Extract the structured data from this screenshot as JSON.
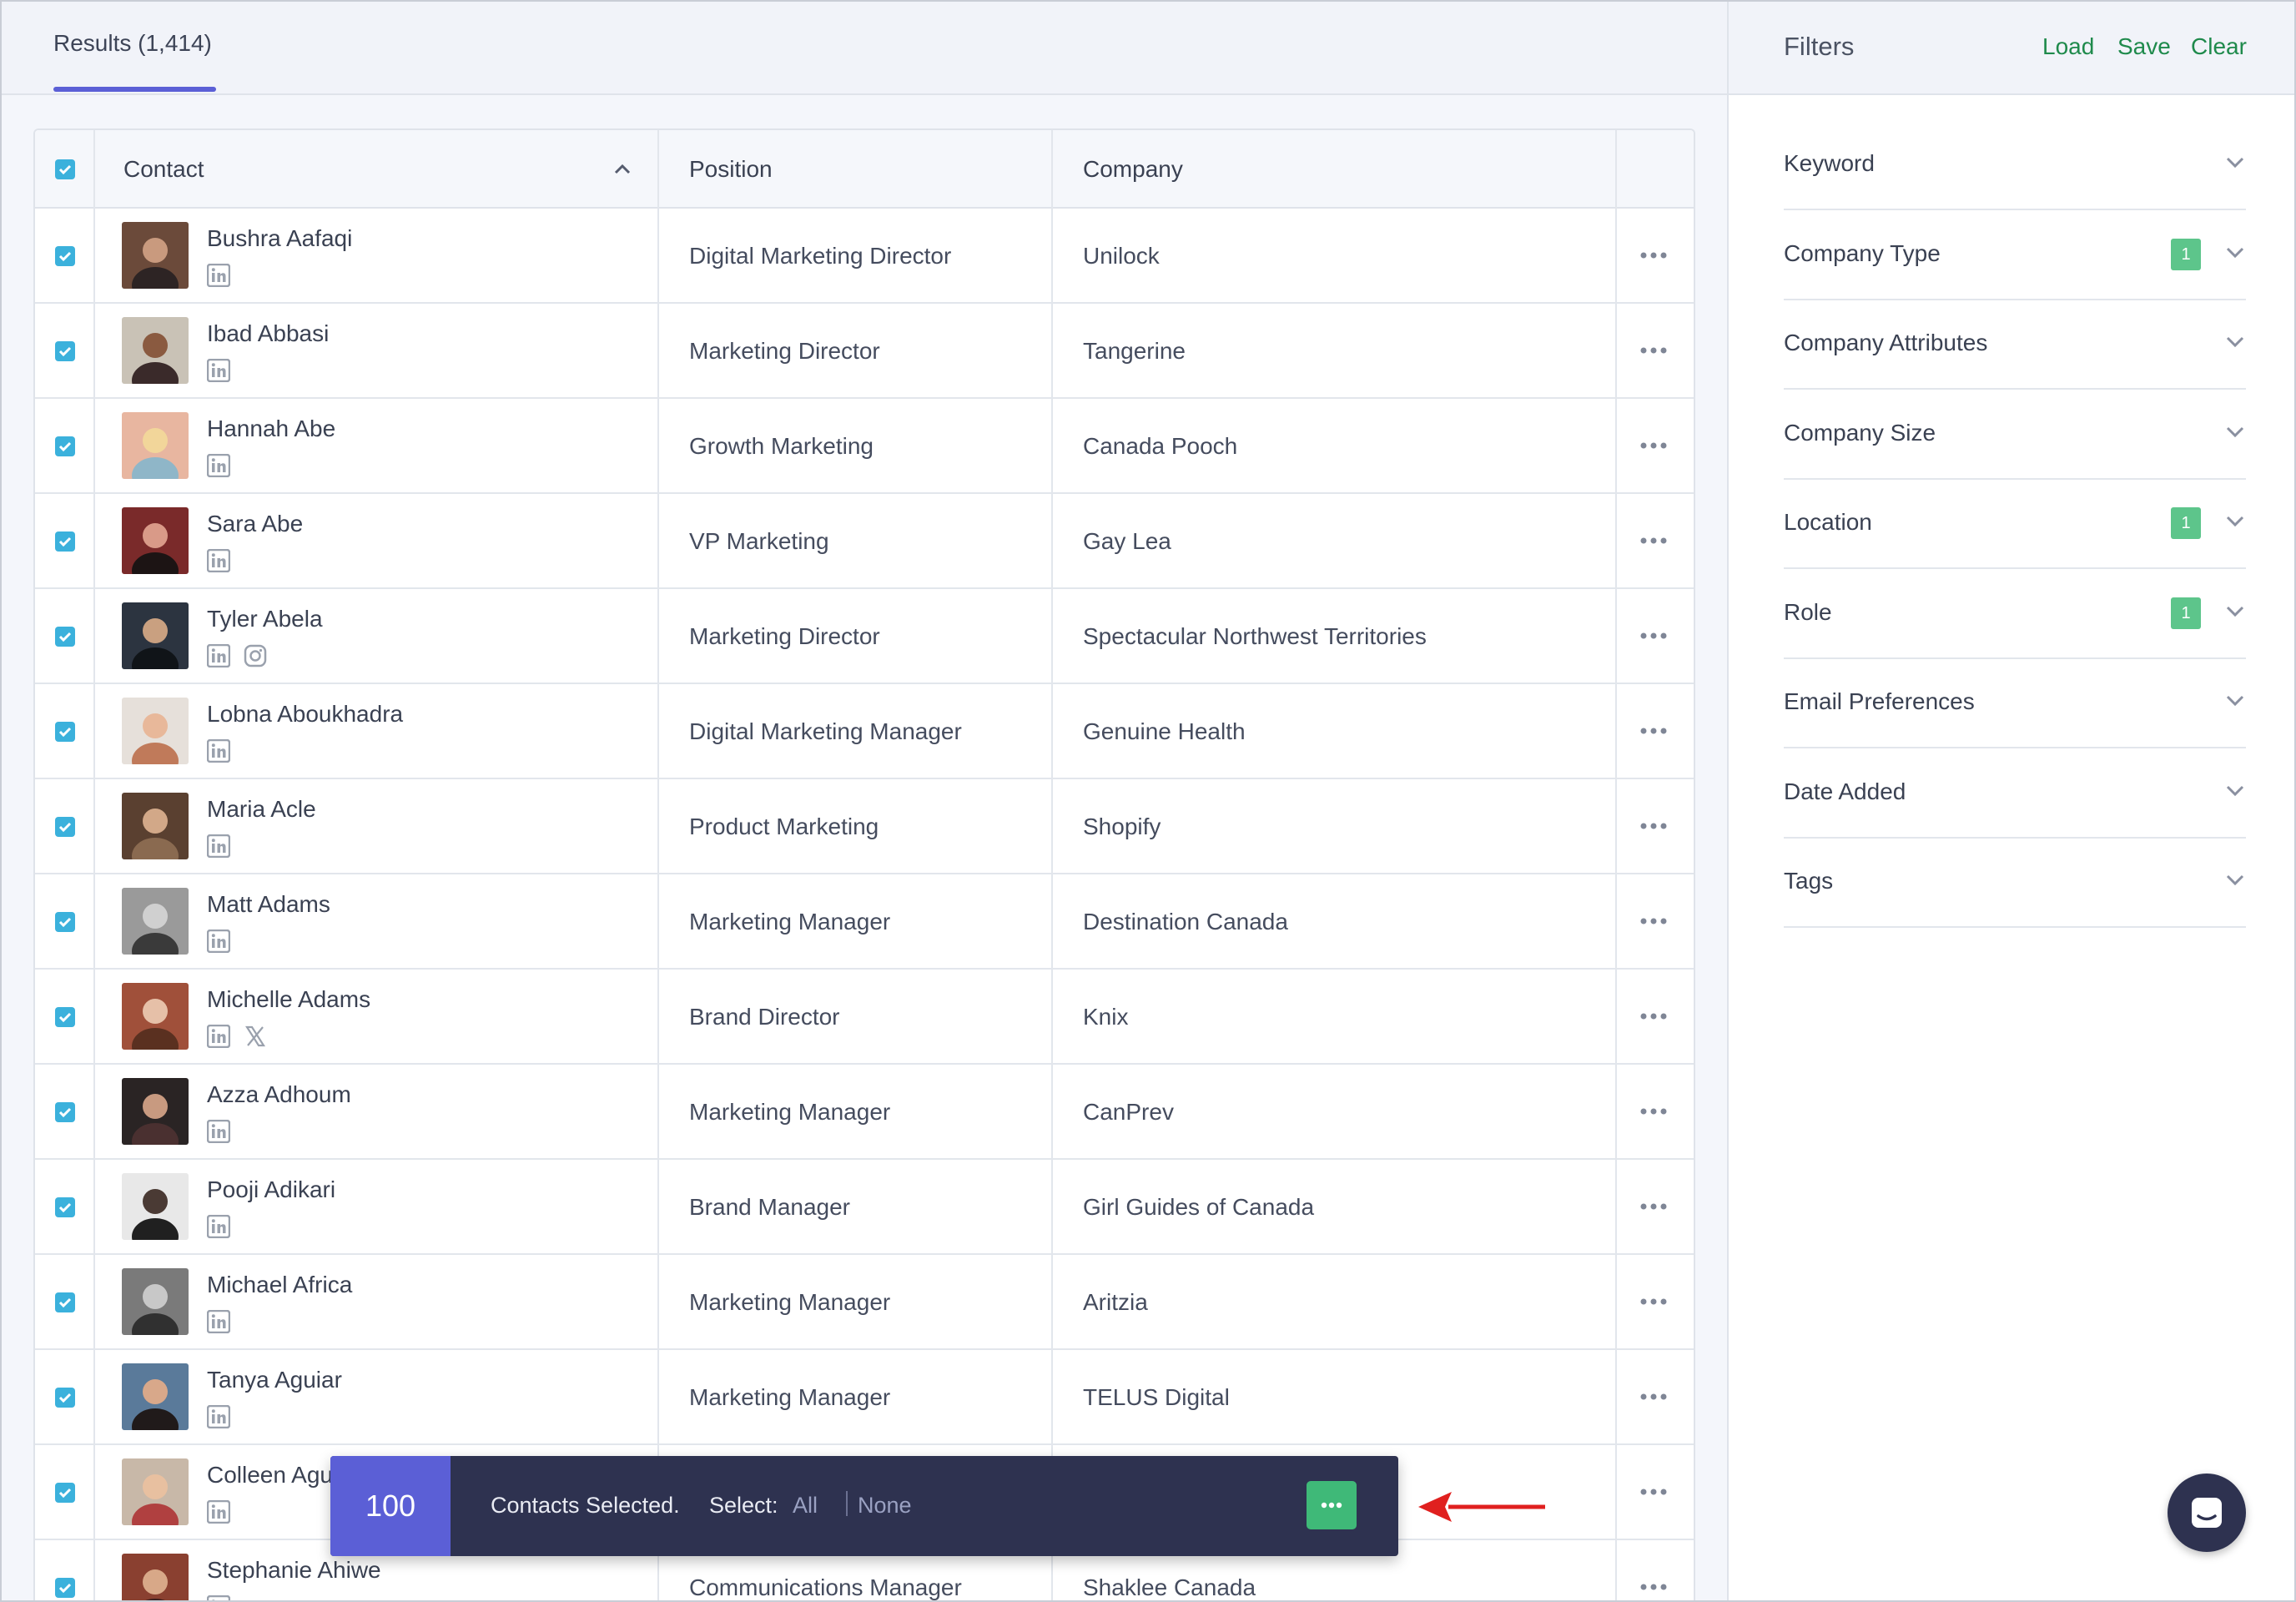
{
  "results_tab": {
    "label": "Results (1,414)"
  },
  "table": {
    "columns": [
      "Contact",
      "Position",
      "Company"
    ],
    "rows": [
      {
        "name": "Bushra Aafaqi",
        "position": "Digital Marketing Director",
        "company": "Unilock",
        "socials": [
          "linkedin-icon"
        ]
      },
      {
        "name": "Ibad Abbasi",
        "position": "Marketing Director",
        "company": "Tangerine",
        "socials": [
          "linkedin-icon"
        ]
      },
      {
        "name": "Hannah Abe",
        "position": "Growth Marketing",
        "company": "Canada Pooch",
        "socials": [
          "linkedin-icon"
        ]
      },
      {
        "name": "Sara Abe",
        "position": "VP Marketing",
        "company": "Gay Lea",
        "socials": [
          "linkedin-icon"
        ]
      },
      {
        "name": "Tyler Abela",
        "position": "Marketing Director",
        "company": "Spectacular Northwest Territories",
        "socials": [
          "linkedin-icon",
          "instagram-icon"
        ]
      },
      {
        "name": "Lobna Aboukhadra",
        "position": "Digital Marketing Manager",
        "company": "Genuine Health",
        "socials": [
          "linkedin-icon"
        ]
      },
      {
        "name": "Maria Acle",
        "position": "Product Marketing",
        "company": "Shopify",
        "socials": [
          "linkedin-icon"
        ]
      },
      {
        "name": "Matt Adams",
        "position": "Marketing Manager",
        "company": "Destination Canada",
        "socials": [
          "linkedin-icon"
        ]
      },
      {
        "name": "Michelle Adams",
        "position": "Brand Director",
        "company": "Knix",
        "socials": [
          "linkedin-icon",
          "x-icon"
        ]
      },
      {
        "name": "Azza Adhoum",
        "position": "Marketing Manager",
        "company": "CanPrev",
        "socials": [
          "linkedin-icon"
        ]
      },
      {
        "name": "Pooji Adikari",
        "position": "Brand Manager",
        "company": "Girl Guides of Canada",
        "socials": [
          "linkedin-icon"
        ]
      },
      {
        "name": "Michael Africa",
        "position": "Marketing Manager",
        "company": "Aritzia",
        "socials": [
          "linkedin-icon"
        ]
      },
      {
        "name": "Tanya Aguiar",
        "position": "Marketing Manager",
        "company": "TELUS Digital",
        "socials": [
          "linkedin-icon"
        ]
      },
      {
        "name": "Colleen Agu",
        "position": "",
        "company": "",
        "socials": [
          "linkedin-icon"
        ]
      },
      {
        "name": "Stephanie Ahiwe",
        "position": "Communications Manager",
        "company": "Shaklee Canada",
        "socials": [
          "linkedin-icon"
        ]
      }
    ]
  },
  "filters": {
    "title": "Filters",
    "actions": {
      "load": "Load",
      "save": "Save",
      "clear": "Clear"
    },
    "items": [
      {
        "label": "Keyword",
        "badge": null
      },
      {
        "label": "Company Type",
        "badge": "1"
      },
      {
        "label": "Company Attributes",
        "badge": null
      },
      {
        "label": "Company Size",
        "badge": null
      },
      {
        "label": "Location",
        "badge": "1"
      },
      {
        "label": "Role",
        "badge": "1"
      },
      {
        "label": "Email Preferences",
        "badge": null
      },
      {
        "label": "Date Added",
        "badge": null
      },
      {
        "label": "Tags",
        "badge": null
      }
    ]
  },
  "selection_bar": {
    "count": "100",
    "text": "Contacts Selected.",
    "select_label": "Select:",
    "all": "All",
    "none": "None"
  },
  "colors": {
    "accent": "#5b5fd6",
    "checkbox": "#3bb1dc",
    "filter_link": "#1f8a4c",
    "badge": "#5dc58b",
    "bar_bg": "#2e3250",
    "arrow": "#e0201f"
  }
}
